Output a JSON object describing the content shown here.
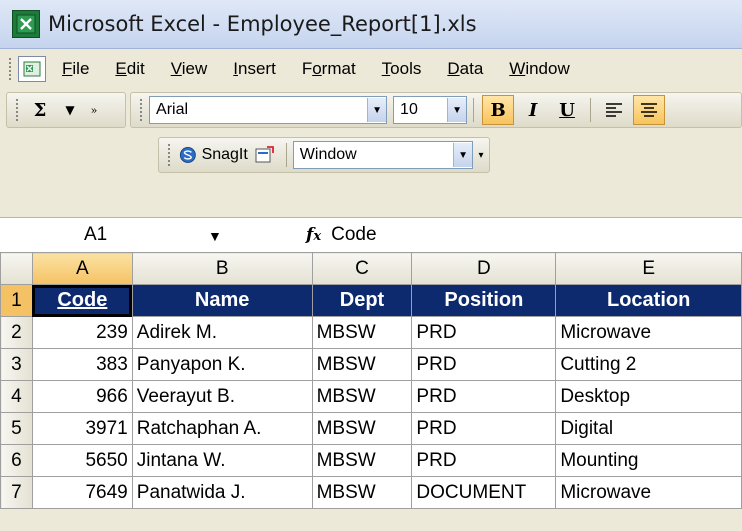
{
  "window": {
    "app_title": "Microsoft Excel - Employee_Report[1].xls"
  },
  "menu": {
    "items": [
      {
        "label": "File",
        "accel": "F",
        "rest": "ile"
      },
      {
        "label": "Edit",
        "accel": "E",
        "rest": "dit"
      },
      {
        "label": "View",
        "accel": "V",
        "rest": "iew"
      },
      {
        "label": "Insert",
        "accel": "I",
        "rest": "nsert"
      },
      {
        "label": "Format",
        "accel": "o",
        "pre": "F",
        "rest": "rmat"
      },
      {
        "label": "Tools",
        "accel": "T",
        "rest": "ools"
      },
      {
        "label": "Data",
        "accel": "D",
        "rest": "ata"
      },
      {
        "label": "Window",
        "accel": "W",
        "rest": "indow"
      }
    ]
  },
  "toolbar": {
    "sum_icon": "Σ",
    "font_name": "Arial",
    "font_size": "10",
    "bold": "B",
    "italic": "I",
    "underline": "U",
    "snagit_label": "SnagIt",
    "snagit_window": "Window"
  },
  "formula_bar": {
    "name_box": "A1",
    "fx": "fx",
    "content": "Code"
  },
  "sheet": {
    "columns": [
      "A",
      "B",
      "C",
      "D",
      "E"
    ],
    "header": [
      "Code",
      "Name",
      "Dept",
      "Position",
      "Location"
    ],
    "rows": [
      {
        "num": "1"
      },
      {
        "num": "2",
        "cells": [
          "239",
          "Adirek M.",
          "MBSW",
          "PRD",
          "Microwave"
        ]
      },
      {
        "num": "3",
        "cells": [
          "383",
          "Panyapon K.",
          "MBSW",
          "PRD",
          "Cutting 2"
        ]
      },
      {
        "num": "4",
        "cells": [
          "966",
          "Veerayut B.",
          "MBSW",
          "PRD",
          "Desktop"
        ]
      },
      {
        "num": "5",
        "cells": [
          "3971",
          "Ratchaphan A.",
          "MBSW",
          "PRD",
          "Digital"
        ]
      },
      {
        "num": "6",
        "cells": [
          "5650",
          "Jintana W.",
          "MBSW",
          "PRD",
          "Mounting"
        ]
      },
      {
        "num": "7",
        "cells": [
          "7649",
          "Panatwida J.",
          "MBSW",
          "DOCUMENT",
          "Microwave"
        ]
      }
    ]
  },
  "colors": {
    "header_fill": "#0e2a6f",
    "header_text": "#ffffff",
    "selection_highlight": "#f4c264"
  }
}
